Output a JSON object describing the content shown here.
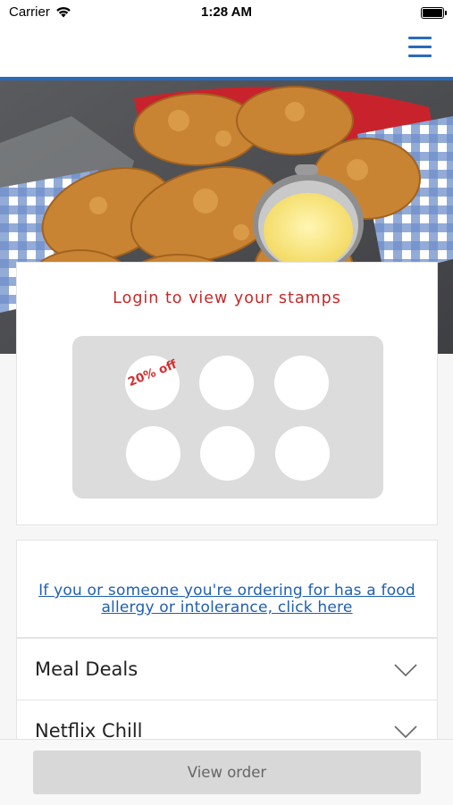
{
  "status_bar": {
    "carrier": "Carrier",
    "time": "1:28 AM"
  },
  "nav": {
    "menu_icon": "hamburger-menu-icon",
    "accent_color": "#2a6bbd"
  },
  "hero": {
    "image": "fried-chicken-strips-with-dipping-sauce"
  },
  "stamps": {
    "title": "Login to view your stamps",
    "reward_label": "20% off",
    "slots": 6,
    "title_color": "#c62828"
  },
  "allergy": {
    "link_text": "If you or someone you're ordering for has a food allergy or intolerance, click here"
  },
  "sections": [
    {
      "label": "Meal Deals",
      "icon": "chevron-down-icon"
    },
    {
      "label": "Netflix Chill",
      "icon": "chevron-down-icon"
    }
  ],
  "footer": {
    "view_order_label": "View order"
  }
}
